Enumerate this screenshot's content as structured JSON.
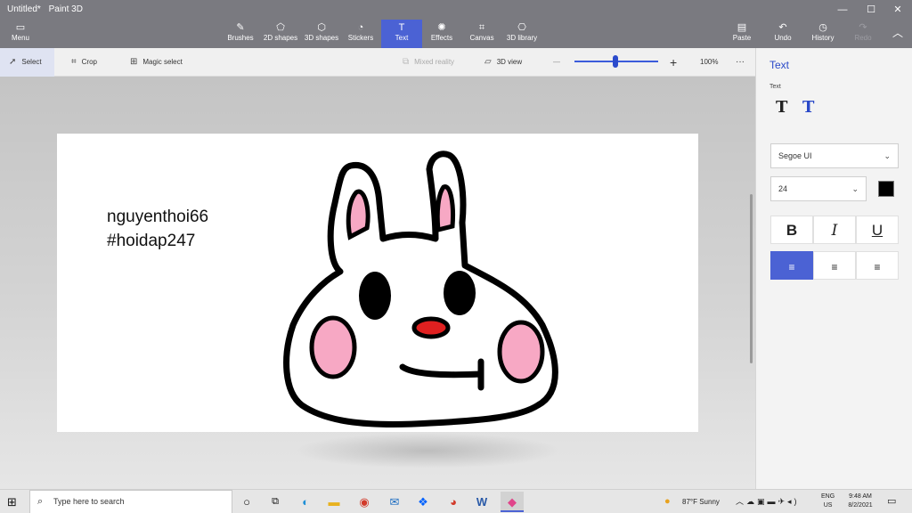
{
  "window": {
    "doc_title": "Untitled*",
    "app_title": "Paint 3D",
    "min_symbol": "—",
    "max_symbol": "☐",
    "close_symbol": "✕"
  },
  "ribbon": {
    "menu_label": "Menu",
    "tools": [
      {
        "label": "Brushes",
        "icon": "brush-icon"
      },
      {
        "label": "2D shapes",
        "icon": "2d-shapes-icon"
      },
      {
        "label": "3D shapes",
        "icon": "3d-shapes-icon"
      },
      {
        "label": "Stickers",
        "icon": "stickers-icon"
      },
      {
        "label": "Text",
        "icon": "text-icon",
        "active": true
      },
      {
        "label": "Effects",
        "icon": "effects-icon"
      },
      {
        "label": "Canvas",
        "icon": "canvas-icon"
      },
      {
        "label": "3D library",
        "icon": "3d-library-icon"
      }
    ],
    "paste_label": "Paste",
    "undo_label": "Undo",
    "history_label": "History",
    "redo_label": "Redo"
  },
  "toolbar": {
    "select_label": "Select",
    "crop_label": "Crop",
    "magic_select_label": "Magic select",
    "mixed_reality_label": "Mixed reality",
    "view_3d_label": "3D view",
    "zoom_minus": "—",
    "zoom_plus": "+",
    "zoom_level": "100%",
    "more": "···",
    "zoom_fraction": 0.47
  },
  "canvas": {
    "text_line1": "nguyenthoi66",
    "text_line2": "#hoidap247",
    "accent_colors": {
      "outline": "#000000",
      "cheeks": "#f7a8c4",
      "nose": "#e02020"
    }
  },
  "side_panel": {
    "title": "Text",
    "section_label": "Text",
    "font_family": "Segoe UI",
    "font_size": "24",
    "text_color": "#000000",
    "bold_label": "B",
    "italic_label": "I",
    "underline_label": "U"
  },
  "taskbar": {
    "search_placeholder": "Type here to search",
    "weather": "87°F  Sunny",
    "language_top": "ENG",
    "language_bottom": "US",
    "time": "9:48 AM",
    "date": "8/2/2021"
  },
  "colors": {
    "accent": "#4b62d4",
    "titlebar": "#7a7a80"
  }
}
